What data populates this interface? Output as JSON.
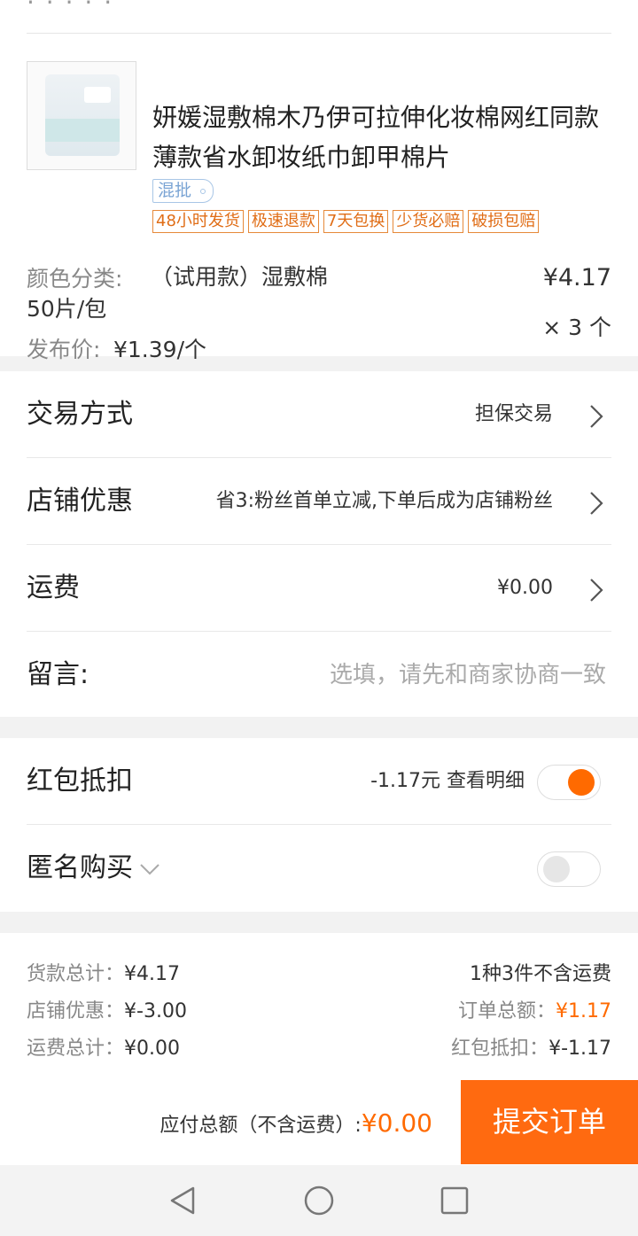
{
  "top_partial": {
    "text": "· · · · ·"
  },
  "product": {
    "title": "妍媛湿敷棉木乃伊可拉伸化妆棉网红同款薄款省水卸妆纸巾卸甲棉片",
    "mix_tag": "混批",
    "tags": [
      "48小时发货",
      "极速退款",
      "7天包换",
      "少货必赔",
      "破损包赔"
    ],
    "sku_label": "颜色分类:",
    "sku_value": "（试用款）湿敷棉50片/包",
    "price_label": "发布价:",
    "price_value": "¥1.39/个",
    "unit_price": "¥4.17",
    "quantity": "× 3 个"
  },
  "rows": {
    "trade_label": "交易方式",
    "trade_value": "担保交易",
    "shop_discount_label": "店铺优惠",
    "shop_discount_value": "省3:粉丝首单立减,下单后成为店铺粉丝",
    "shipping_label": "运费",
    "shipping_value": "¥0.00",
    "message_label": "留言:",
    "message_placeholder": "选填，请先和商家协商一致"
  },
  "options": {
    "redpack_label": "红包抵扣",
    "redpack_value": "-1.17元  查看明细",
    "redpack_on": true,
    "anonymous_label": "匿名购买",
    "anonymous_on": false
  },
  "summary": {
    "goods_total_label": "货款总计：",
    "goods_total_value": "¥4.17",
    "shop_discount_label": "店铺优惠：",
    "shop_discount_value": "¥-3.00",
    "shipping_total_label": "运费总计：",
    "shipping_total_value": "¥0.00",
    "count_text": "1种3件不含运费",
    "order_total_label": "订单总额：",
    "order_total_value": "¥1.17",
    "redpack_deduct_label": "红包抵扣：",
    "redpack_deduct_value": "¥-1.17"
  },
  "paybar": {
    "label": "应付总额（不含运费）:",
    "amount": "¥0.00",
    "submit_label": "提交订单"
  },
  "colors": {
    "accent": "#ff6a00",
    "tag_border": "#e6893a",
    "mix_tag": "#7aa4d4"
  },
  "navbar": {
    "icons": [
      "back-icon",
      "home-icon",
      "recents-icon"
    ]
  }
}
